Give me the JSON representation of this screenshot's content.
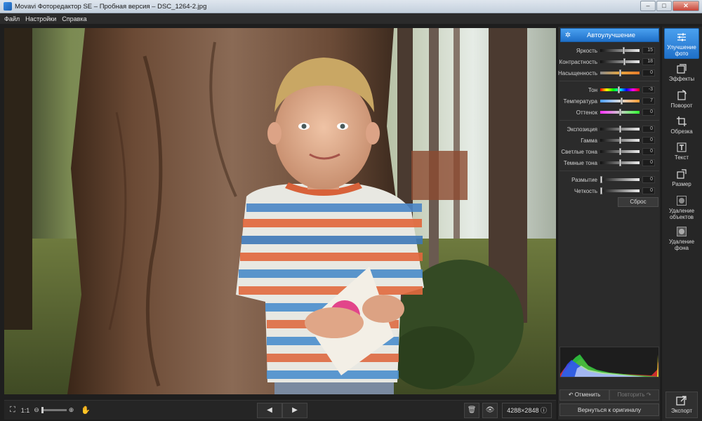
{
  "window": {
    "title": "Movavi Фоторедактор SE – Пробная версия – DSC_1264-2.jpg"
  },
  "menu": [
    "Файл",
    "Настройки",
    "Справка"
  ],
  "panel": {
    "auto_label": "Автоулучшение",
    "groups": [
      [
        {
          "label": "Яркость",
          "value": "15",
          "pos": 0.6,
          "track": "gray"
        },
        {
          "label": "Контрастность",
          "value": "18",
          "pos": 0.62,
          "track": "gray"
        },
        {
          "label": "Насыщенность",
          "value": "0",
          "pos": 0.5,
          "track": "warm"
        }
      ],
      [
        {
          "label": "Тон",
          "value": "-3",
          "pos": 0.48,
          "track": "rainbow"
        },
        {
          "label": "Температура",
          "value": "7",
          "pos": 0.55,
          "track": "temp"
        },
        {
          "label": "Оттенок",
          "value": "0",
          "pos": 0.5,
          "track": "tint"
        }
      ],
      [
        {
          "label": "Экспозиция",
          "value": "0",
          "pos": 0.5,
          "track": "gray"
        },
        {
          "label": "Гамма",
          "value": "0",
          "pos": 0.5,
          "track": "gray"
        },
        {
          "label": "Светлые тона",
          "value": "0",
          "pos": 0.5,
          "track": "gray"
        },
        {
          "label": "Темные тона",
          "value": "0",
          "pos": 0.5,
          "track": "gray"
        }
      ],
      [
        {
          "label": "Размытие",
          "value": "0",
          "pos": 0.0,
          "track": "gray"
        },
        {
          "label": "Четкость",
          "value": "0",
          "pos": 0.0,
          "track": "gray"
        }
      ]
    ],
    "reset_label": "Сброс",
    "undo_label": "Отменить",
    "redo_label": "Повторить",
    "revert_label": "Вернуться к оригиналу"
  },
  "tools": [
    {
      "label": "Улучшение фото",
      "icon": "sliders-icon",
      "active": true
    },
    {
      "label": "Эффекты",
      "icon": "effects-icon",
      "active": false
    },
    {
      "label": "Поворот",
      "icon": "rotate-icon",
      "active": false
    },
    {
      "label": "Обрезка",
      "icon": "crop-icon",
      "active": false
    },
    {
      "label": "Текст",
      "icon": "text-icon",
      "active": false
    },
    {
      "label": "Размер",
      "icon": "resize-icon",
      "active": false
    },
    {
      "label": "Удаление объектов",
      "icon": "object-removal-icon",
      "active": false
    },
    {
      "label": "Удаление фона",
      "icon": "background-removal-icon",
      "active": false
    }
  ],
  "export_label": "Экспорт",
  "bottom": {
    "ratio_label": "1:1",
    "dimensions": "4288×2848"
  },
  "colors": {
    "accent": "#2d85dd",
    "panel_bg": "#2b2b2b"
  }
}
